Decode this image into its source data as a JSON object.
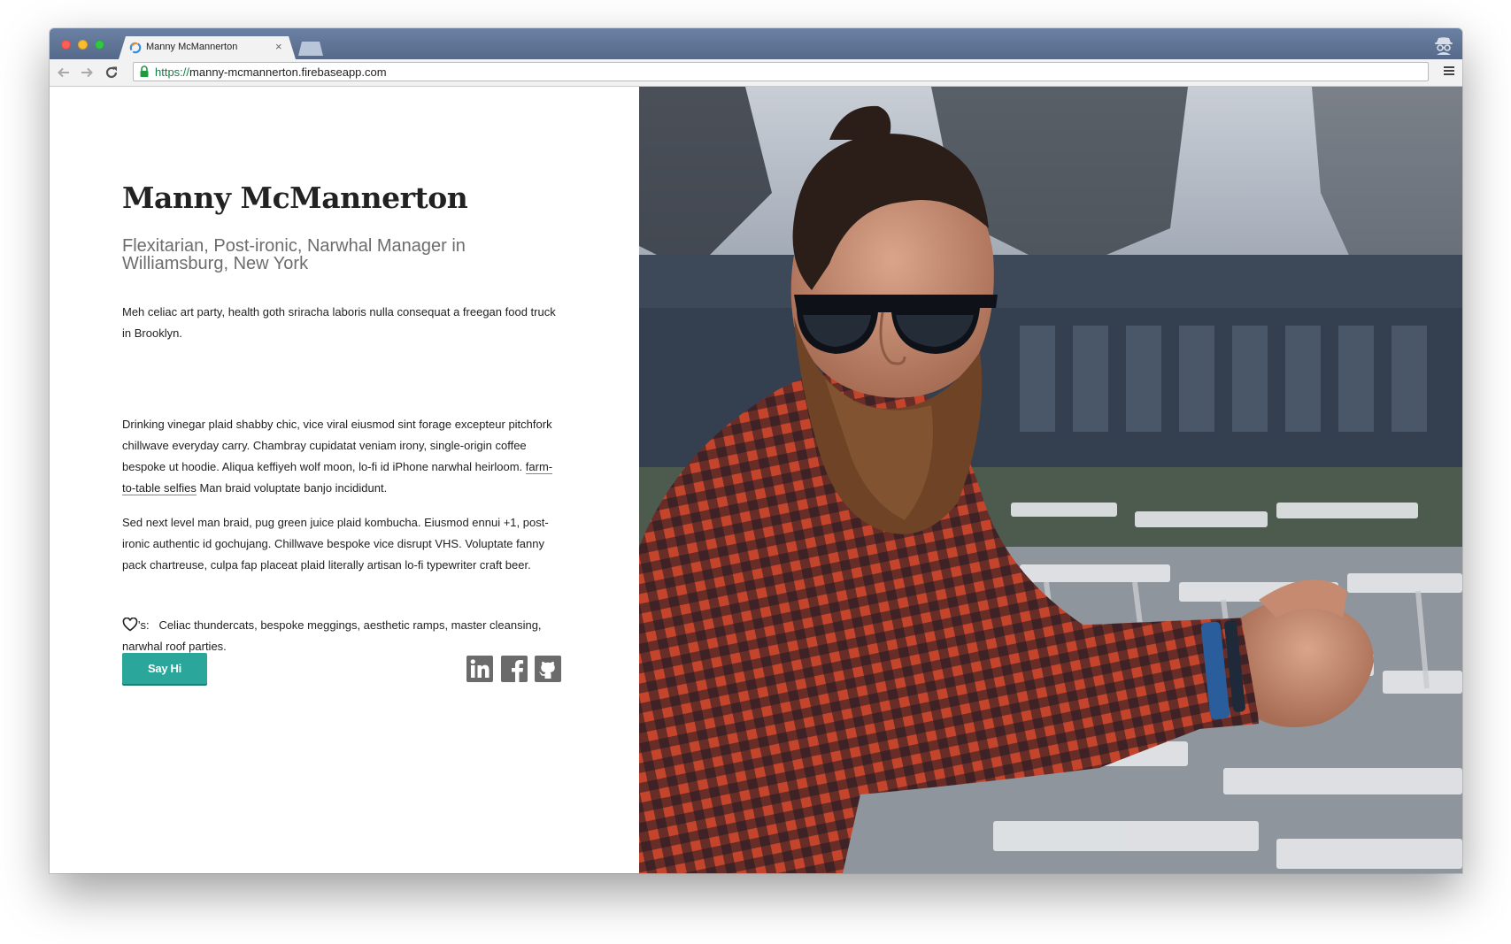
{
  "browser": {
    "tab_title": "Manny McMannerton",
    "tab_close": "×",
    "url_scheme": "https://",
    "url_rest": "manny-mcmannerton.firebaseapp.com"
  },
  "profile": {
    "name": "Manny McMannerton",
    "tagline": "Flexitarian, Post-ironic, Narwhal Manager in Williamsburg, New York",
    "paragraph1": "Meh celiac art party, health goth sriracha laboris nulla consequat a freegan food truck in Brooklyn.",
    "paragraph2_before_link": "Drinking vinegar plaid shabby chic, vice viral eiusmod sint forage excepteur pitchfork chillwave everyday carry. Chambray cupidatat veniam irony, single-origin coffee bespoke ut hoodie. Aliqua keffiyeh wolf moon, lo-fi id iPhone narwhal heirloom.",
    "paragraph2_link": "farm-to-table selfies",
    "paragraph2_after_link": "Man braid voluptate banjo incididunt.",
    "paragraph3": "Sed next level man braid, pug green juice plaid kombucha. Eiusmod ennui +1, post-ironic authentic id gochujang. Chillwave bespoke vice disrupt VHS. Voluptate fanny pack chartreuse, culpa fap placeat plaid literally artisan lo-fi typewriter craft beer.",
    "likes_suffix": "'s:",
    "likes_text": "Celiac thundercats, bespoke meggings, aesthetic ramps, master cleansing, narwhal roof parties.",
    "cta_label": "Say Hi"
  },
  "icons": [
    "heart-icon",
    "linkedin-icon",
    "facebook-icon",
    "github-icon",
    "lock-icon",
    "back-icon",
    "forward-icon",
    "reload-icon",
    "menu-icon",
    "incognito-icon"
  ],
  "colors": {
    "accent": "#2aa79a",
    "titlebar": "#5f7494",
    "social_icon": "#6b6b6b",
    "url_scheme": "#0b8043"
  }
}
